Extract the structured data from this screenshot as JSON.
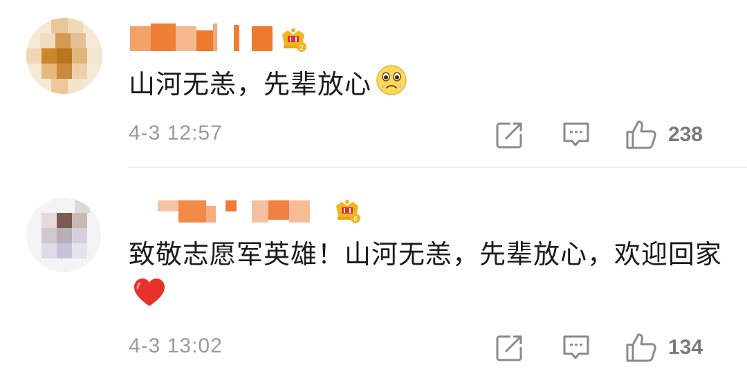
{
  "comments": [
    {
      "username": "",
      "user_badge_icon": "crown-badge-icon",
      "badge_level": "2",
      "text": "山河无恙，先辈放心",
      "emoji": "tearful-face-emoji",
      "timestamp": "4-3 12:57",
      "repost_icon": "share-icon",
      "comment_icon": "comment-icon",
      "like_icon": "thumbs-up-icon",
      "like_count": "238"
    },
    {
      "username": "",
      "user_badge_icon": "crown-badge-icon",
      "badge_level": "6",
      "text": "致敬志愿军英雄！山河无恙，先辈放心，欢迎回家",
      "emoji": "red-heart-emoji",
      "timestamp": "4-3 13:02",
      "repost_icon": "share-icon",
      "comment_icon": "comment-icon",
      "like_icon": "thumbs-up-icon",
      "like_count": "134"
    }
  ],
  "colors": {
    "username_mosaic": "#f07a2a",
    "crown_gold": "#f2b51f",
    "crown_red": "#d9342b",
    "timestamp": "#9a9a9a",
    "icon": "#8a8a8a"
  }
}
